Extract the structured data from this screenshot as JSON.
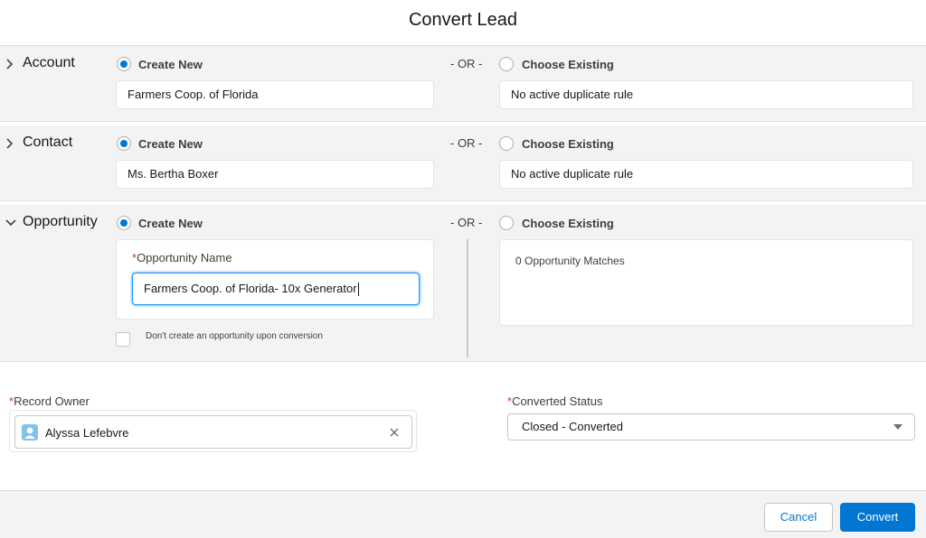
{
  "modal": {
    "title": "Convert Lead"
  },
  "sections": {
    "account": {
      "label": "Account",
      "create_new_label": "Create New",
      "or_label": "- OR -",
      "choose_existing_label": "Choose Existing",
      "new_value": "Farmers Coop. of Florida",
      "existing_value": "No active duplicate rule",
      "selected": "create_new"
    },
    "contact": {
      "label": "Contact",
      "create_new_label": "Create New",
      "or_label": "- OR -",
      "choose_existing_label": "Choose Existing",
      "new_value": "Ms. Bertha Boxer",
      "existing_value": "No active duplicate rule",
      "selected": "create_new"
    },
    "opportunity": {
      "label": "Opportunity",
      "create_new_label": "Create New",
      "or_label": "- OR -",
      "choose_existing_label": "Choose Existing",
      "name_label": "Opportunity Name",
      "name_required": "*",
      "name_value": "Farmers Coop. of Florida- 10x Generator",
      "no_opportunity_label": "Don't create an opportunity upon conversion",
      "no_opportunity_checked": false,
      "matches_text": "0 Opportunity Matches",
      "selected": "create_new"
    }
  },
  "record_owner": {
    "label": "Record Owner",
    "required": "*",
    "value": "Alyssa Lefebvre",
    "icon": "user-avatar-icon"
  },
  "converted_status": {
    "label": "Converted Status",
    "required": "*",
    "value": "Closed - Converted"
  },
  "footer": {
    "cancel_label": "Cancel",
    "convert_label": "Convert"
  },
  "colors": {
    "brand": "#0176d3",
    "section_bg": "#f3f3f3",
    "required": "#c23934",
    "focus": "#1b96ff"
  }
}
